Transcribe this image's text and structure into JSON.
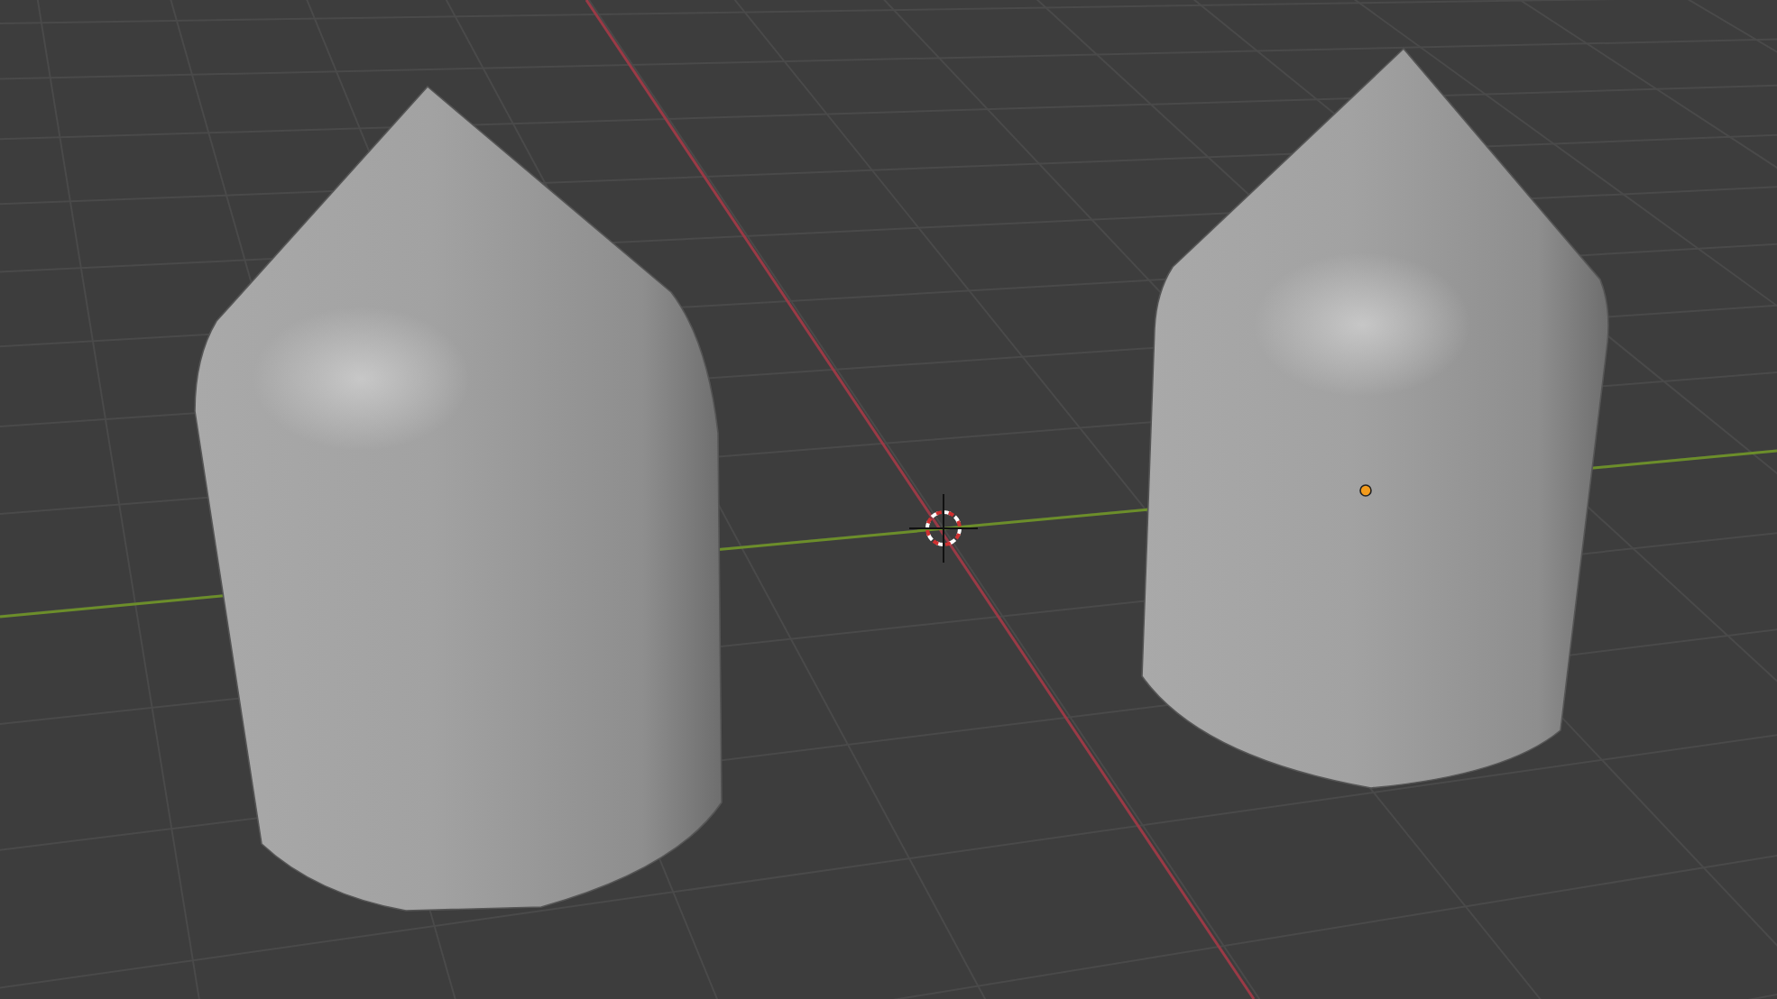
{
  "objects": [
    {
      "selected": false
    },
    {
      "selected": true
    }
  ]
}
